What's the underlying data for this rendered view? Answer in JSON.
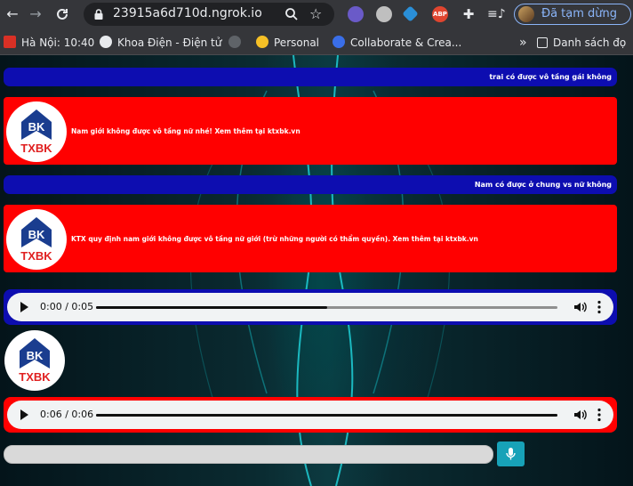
{
  "browser": {
    "url": "23915a6d710d.ngrok.io",
    "profile_status": "Đã tạm dừng",
    "extensions": [
      "owl-extension-icon",
      "shield-extension-icon",
      "diamond-extension-icon",
      "adblock-plus-icon",
      "puzzle-extensions-icon",
      "media-controls-icon"
    ],
    "abp_label": "ABP"
  },
  "bookmarks": {
    "items": [
      {
        "label": "Hà Nội: 10:40",
        "icon": "weather-icon"
      },
      {
        "label": "Khoa Điện - Điện tử",
        "icon": "globe-icon"
      },
      {
        "label": "",
        "icon": "film-reel-icon"
      },
      {
        "label": "Personal",
        "icon": "smiley-icon"
      },
      {
        "label": "Collaborate & Crea...",
        "icon": "collaborate-icon"
      }
    ],
    "overflow": "»",
    "reading_list": "Danh sách đọ"
  },
  "chat": {
    "messages": [
      {
        "type": "question",
        "text": "trai có được vô tầng gái không"
      },
      {
        "type": "answer",
        "text": "Nam giới không được vô tầng nữ nhé! Xem thêm tại ktxbk.vn"
      },
      {
        "type": "question",
        "text": "Nam có được ở chung vs nữ không"
      },
      {
        "type": "answer",
        "text": "KTX quy định nam giới không được vô tầng nữ giới (trừ những người có thẩm quyền). Xem thêm tại ktxbk.vn"
      }
    ],
    "audio_1": {
      "time": "0:00 / 0:05",
      "progress": 0.5
    },
    "audio_2": {
      "time": "0:06 / 0:06",
      "progress": 1.0
    },
    "logo_text": "TXBK",
    "logo_mark": "BK",
    "input_value": "",
    "accent_colors": {
      "question": "#0d0db0",
      "answer": "#ff0000",
      "mic": "#17a2b8"
    }
  }
}
